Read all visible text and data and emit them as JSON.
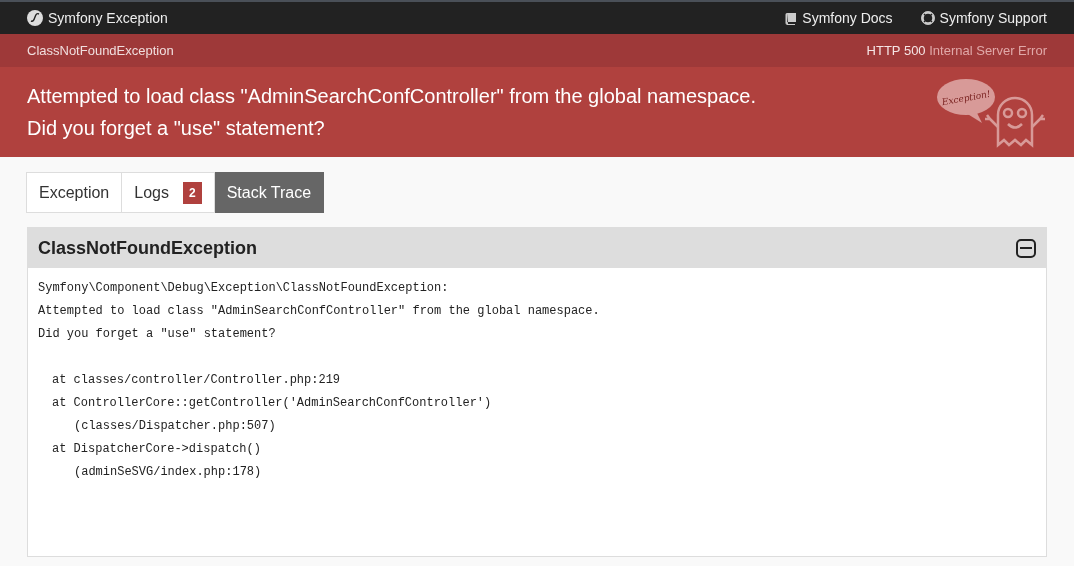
{
  "top_bar": {
    "title": "Symfony Exception",
    "links": [
      {
        "kind": "docs",
        "label": "Symfony Docs"
      },
      {
        "kind": "support",
        "label": "Symfony Support"
      }
    ]
  },
  "header": {
    "exception_class": "ClassNotFoundException",
    "status_code": "HTTP 500",
    "status_text": "Internal Server Error",
    "message_lines": [
      "Attempted to load class \"AdminSearchConfController\" from the global namespace.",
      "Did you forget a \"use\" statement?"
    ],
    "mascot_bubble": "Exception!"
  },
  "tabs": [
    {
      "label": "Exception",
      "selected": false
    },
    {
      "label": "Logs",
      "badge": "2",
      "selected": false
    },
    {
      "label": "Stack Trace",
      "selected": true
    }
  ],
  "panel": {
    "title": "ClassNotFoundException",
    "expanded": true,
    "message_lines": [
      "Symfony\\Component\\Debug\\Exception\\ClassNotFoundException:",
      "Attempted to load class \"AdminSearchConfController\" from the global namespace.",
      "Did you forget a \"use\" statement?"
    ],
    "trace": [
      {
        "text": "at classes/controller/Controller.php:219"
      },
      {
        "text": "at ControllerCore::getController('AdminSearchConfController')",
        "children": [
          {
            "text": "(classes/Dispatcher.php:507)"
          }
        ]
      },
      {
        "text": "at DispatcherCore->dispatch()",
        "children": [
          {
            "text": "(adminSeSVG/index.php:178)"
          }
        ]
      }
    ]
  }
}
